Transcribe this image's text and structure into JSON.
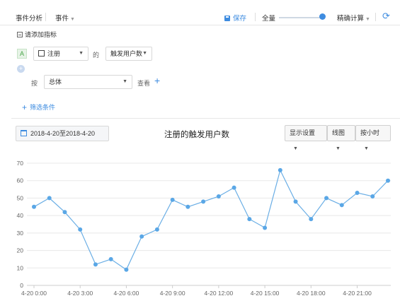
{
  "topbar": {
    "title": "事件分析",
    "event_menu": "事件",
    "save_label": "保存",
    "volume_label": "全量",
    "calc_label": "精确计算",
    "slider_fraction": 1.0
  },
  "query": {
    "add_metric_label": "请添加指标",
    "metric_badge": "A",
    "event_value": "注册",
    "of_label": "的",
    "metric_value": "触发用户数",
    "by_label": "按",
    "group_value": "总体",
    "view_label": "查看",
    "filter_label": "筛选条件"
  },
  "toolbar": {
    "date_range": "2018-4-20至2018-4-20",
    "chart_title": "注册的触发用户数",
    "display_settings": "显示设置",
    "chart_type": "线图",
    "granularity": "按小时"
  },
  "colors": {
    "accent": "#3e8ce0",
    "line": "#6aaee5",
    "point": "#5aa7e6",
    "grid": "#e8e8e8"
  },
  "icons": {
    "save": "save-icon",
    "refresh": "refresh-icon",
    "calendar": "calendar-icon",
    "event": "event-icon",
    "add": "plus-icon"
  },
  "chart_data": {
    "type": "line",
    "title": "注册的触发用户数",
    "x": [
      "4-20 0:00",
      "4-20 1:00",
      "4-20 2:00",
      "4-20 3:00",
      "4-20 4:00",
      "4-20 5:00",
      "4-20 6:00",
      "4-20 7:00",
      "4-20 8:00",
      "4-20 9:00",
      "4-20 10:00",
      "4-20 11:00",
      "4-20 12:00",
      "4-20 13:00",
      "4-20 14:00",
      "4-20 15:00",
      "4-20 16:00",
      "4-20 17:00",
      "4-20 18:00",
      "4-20 19:00",
      "4-20 20:00",
      "4-20 21:00",
      "4-20 22:00",
      "4-20 23:00"
    ],
    "x_tick_labels": [
      "4-20 0:00",
      "4-20 3:00",
      "4-20 6:00",
      "4-20 9:00",
      "4-20 12:00",
      "4-20 15:00",
      "4-20 18:00",
      "4-20 21:00"
    ],
    "values": [
      45,
      50,
      42,
      32,
      12,
      15,
      9,
      28,
      32,
      49,
      45,
      48,
      51,
      56,
      38,
      33,
      66,
      48,
      38,
      50,
      46,
      53,
      51,
      60
    ],
    "ylim": [
      0,
      70
    ],
    "y_ticks": [
      0,
      10,
      20,
      30,
      40,
      50,
      60,
      70
    ],
    "grid": true
  }
}
